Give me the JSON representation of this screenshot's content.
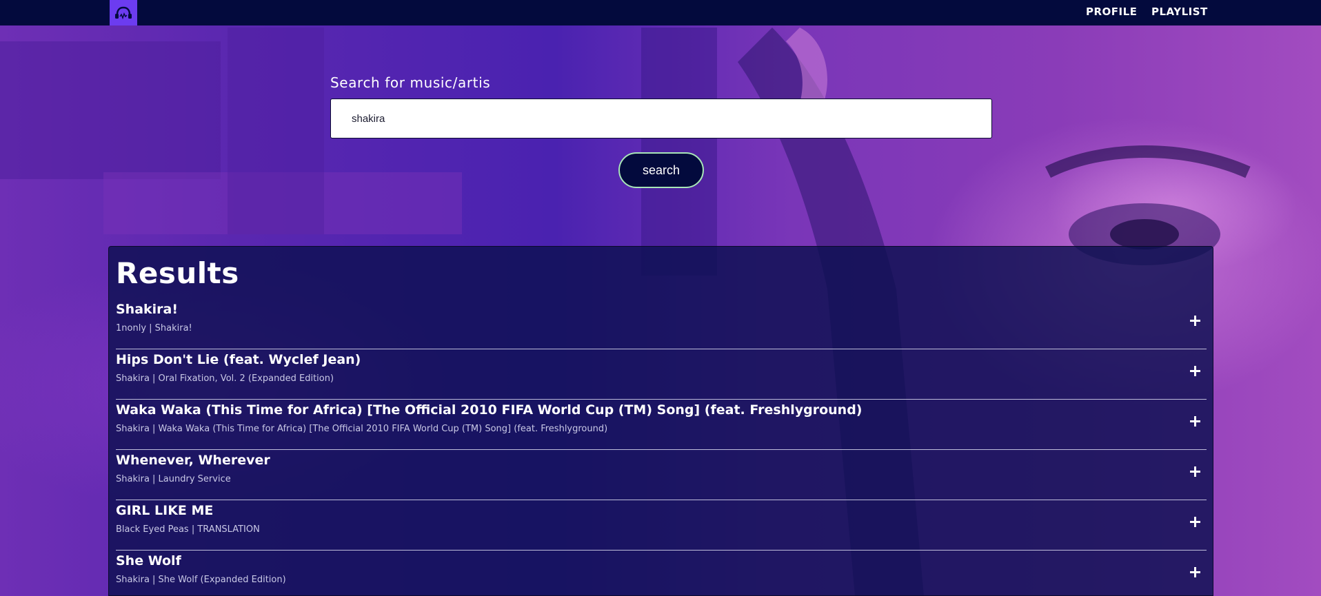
{
  "nav": {
    "logo_icon": "headphones-icon",
    "links": [
      "PROFILE",
      "PLAYLIST"
    ]
  },
  "search": {
    "label": "Search for music/artis",
    "value": "shakira",
    "button_label": "search"
  },
  "results": {
    "title": "Results",
    "items": [
      {
        "title": "Shakira!",
        "subtitle": "1nonly | Shakira!"
      },
      {
        "title": "Hips Don't Lie (feat. Wyclef Jean)",
        "subtitle": "Shakira | Oral Fixation, Vol. 2 (Expanded Edition)"
      },
      {
        "title": "Waka Waka (This Time for Africa) [The Official 2010 FIFA World Cup (TM) Song] (feat. Freshlyground)",
        "subtitle": "Shakira | Waka Waka (This Time for Africa) [The Official 2010 FIFA World Cup (TM) Song] (feat. Freshlyground)"
      },
      {
        "title": "Whenever, Wherever",
        "subtitle": "Shakira | Laundry Service"
      },
      {
        "title": "GIRL LIKE ME",
        "subtitle": "Black Eyed Peas | TRANSLATION"
      },
      {
        "title": "She Wolf",
        "subtitle": "Shakira | She Wolf (Expanded Edition)"
      }
    ]
  },
  "colors": {
    "navbar": "#030a3d",
    "logo_bg": "#6c3cf0",
    "panel": "#0c1050",
    "button_border": "#a8e6b8"
  }
}
